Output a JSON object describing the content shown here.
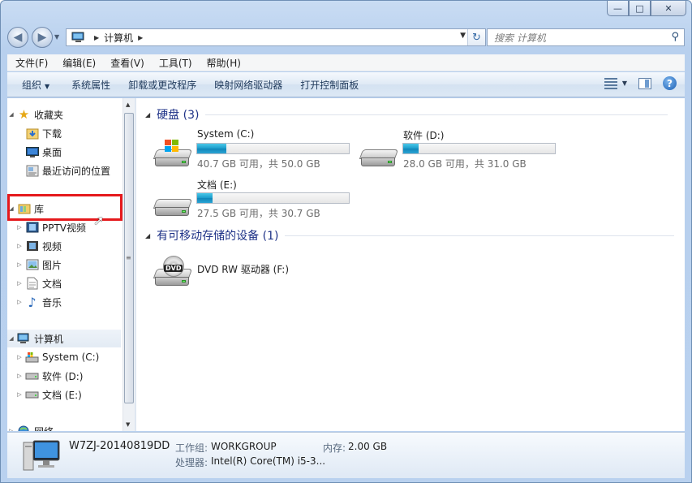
{
  "window": {
    "caption_buttons": {
      "minimize": "—",
      "maximize": "□",
      "close": "✕"
    }
  },
  "navigation": {
    "back_icon": "◀",
    "forward_icon": "▶",
    "address_path": [
      "计算机"
    ],
    "search_placeholder": "搜索 计算机"
  },
  "menubar": {
    "items": [
      "文件(F)",
      "编辑(E)",
      "查看(V)",
      "工具(T)",
      "帮助(H)"
    ]
  },
  "commandbar": {
    "items": [
      "组织",
      "系统属性",
      "卸载或更改程序",
      "映射网络驱动器",
      "打开控制面板"
    ],
    "help_label": "?"
  },
  "sidebar": {
    "favorites": {
      "label": "收藏夹",
      "items": [
        "下载",
        "桌面",
        "最近访问的位置"
      ]
    },
    "libraries": {
      "label": "库",
      "items": [
        "PPTV视频",
        "视频",
        "图片",
        "文档",
        "音乐"
      ]
    },
    "computer": {
      "label": "计算机",
      "items": [
        "System (C:)",
        "软件 (D:)",
        "文档 (E:)"
      ]
    },
    "network": {
      "label": "网络"
    }
  },
  "content": {
    "hard_disks": {
      "header": "硬盘 (3)",
      "drives": [
        {
          "name": "System (C:)",
          "info": "40.7 GB 可用，共 50.0 GB",
          "used_fraction": 0.19
        },
        {
          "name": "软件 (D:)",
          "info": "28.0 GB 可用，共 31.0 GB",
          "used_fraction": 0.1
        },
        {
          "name": "文档 (E:)",
          "info": "27.5 GB 可用，共 30.7 GB",
          "used_fraction": 0.1
        }
      ]
    },
    "removable": {
      "header": "有可移动存储的设备 (1)",
      "devices": [
        {
          "name": "DVD RW 驱动器 (F:)",
          "badge": "DVD"
        }
      ]
    }
  },
  "details": {
    "computer_name": "W7ZJ-20140819DD",
    "workgroup_label": "工作组:",
    "workgroup_value": "WORKGROUP",
    "memory_label": "内存:",
    "memory_value": "2.00 GB",
    "processor_label": "处理器:",
    "processor_value": "Intel(R) Core(TM) i5-3..."
  },
  "colors": {
    "highlight_box": "#e5191c",
    "group_header": "#1e3287",
    "drive_bar_fill": "#1b9bcb"
  }
}
